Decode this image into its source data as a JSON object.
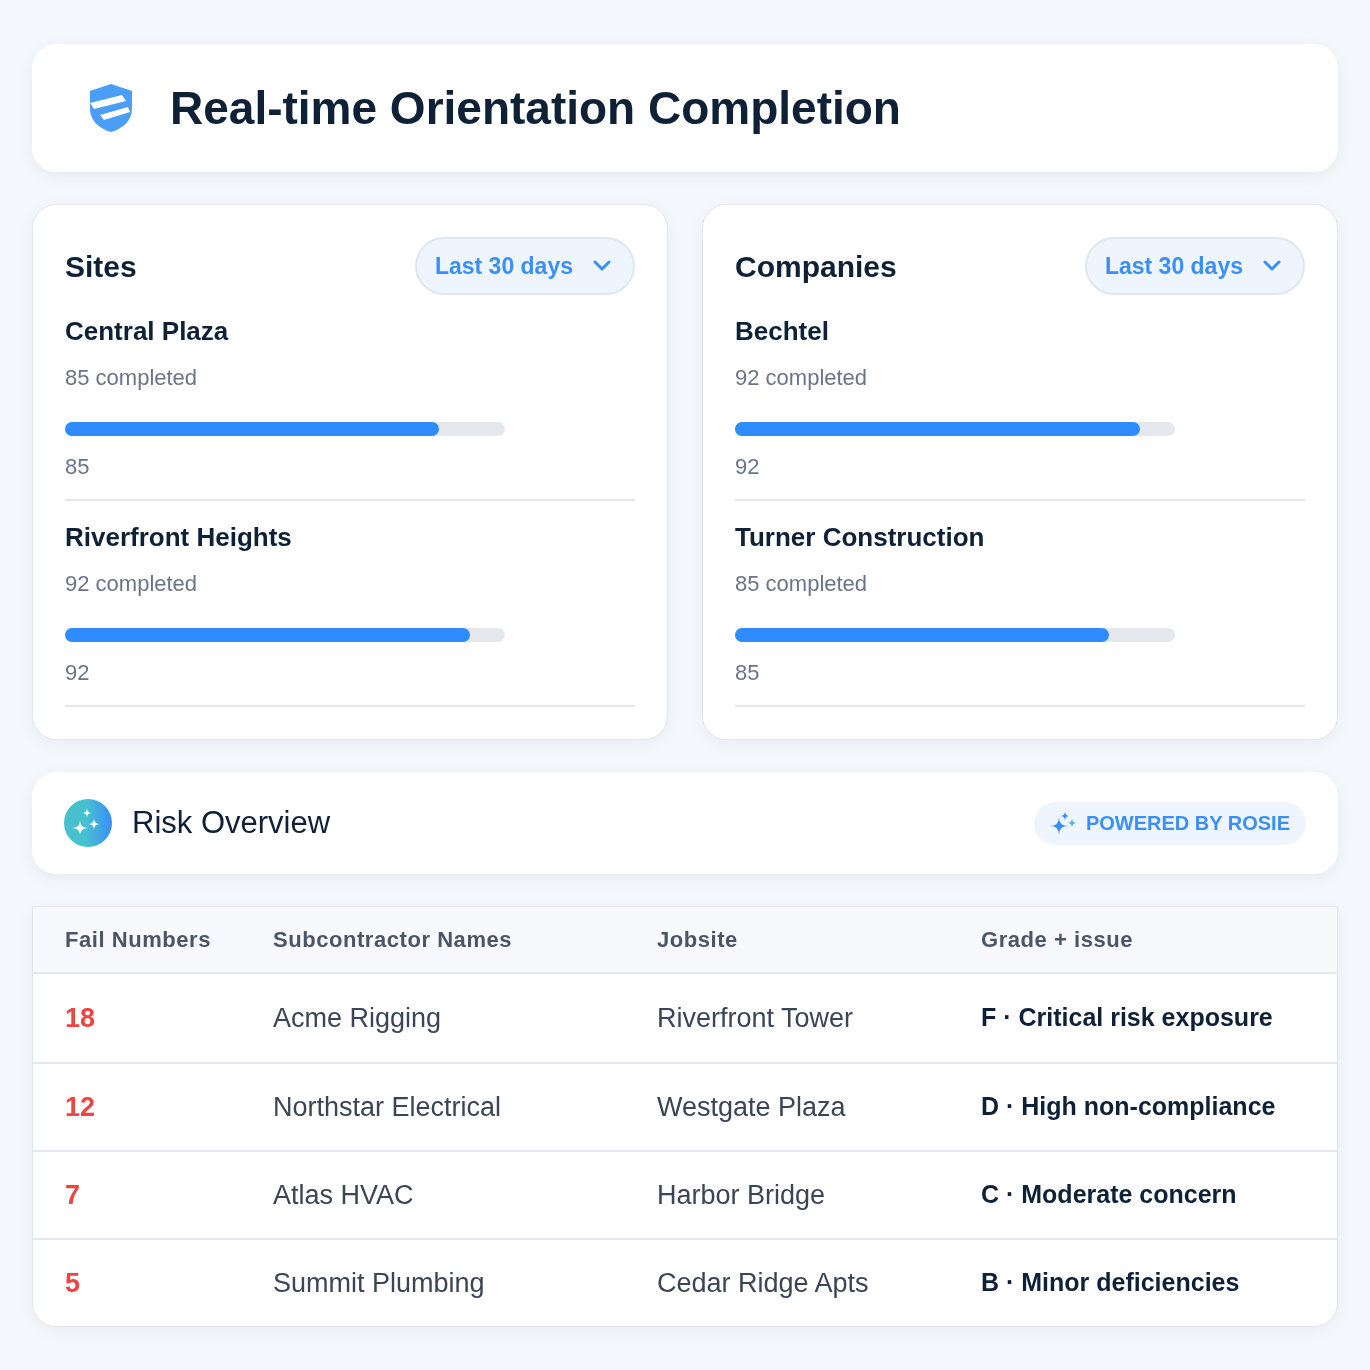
{
  "header": {
    "title": "Real-time Orientation Completion"
  },
  "panels": [
    {
      "title": "Sites",
      "filter": "Last 30 days",
      "items": [
        {
          "name": "Central Plaza",
          "completed": "85 completed",
          "level": 0.85,
          "value": "85"
        },
        {
          "name": "Riverfront Heights",
          "completed": "92 completed",
          "level": 0.92,
          "value": "92"
        }
      ]
    },
    {
      "title": "Companies",
      "filter": "Last 30 days",
      "items": [
        {
          "name": "Bechtel",
          "completed": "92 completed",
          "level": 0.92,
          "value": "92"
        },
        {
          "name": "Turner Construction",
          "completed": "85 completed",
          "level": 0.85,
          "value": "85"
        }
      ]
    }
  ],
  "risk_overview": {
    "title": "Risk Overview",
    "badge": "POWERED BY ROSIE"
  },
  "table": {
    "columns": [
      "Fail Numbers",
      "Subcontractor Names",
      "Jobsite",
      "Grade + issue"
    ],
    "rows": [
      {
        "fail_numbers": "18",
        "subcontractor": "Acme Rigging",
        "jobsite": "Riverfront Tower",
        "grade_issue": "F · Critical risk exposure"
      },
      {
        "fail_numbers": "12",
        "subcontractor": "Northstar Electrical",
        "jobsite": "Westgate Plaza",
        "grade_issue": "D · High non-compliance"
      },
      {
        "fail_numbers": "7",
        "subcontractor": "Atlas HVAC",
        "jobsite": "Harbor Bridge",
        "grade_issue": "C · Moderate concern"
      },
      {
        "fail_numbers": "5",
        "subcontractor": "Summit Plumbing",
        "jobsite": "Cedar Ridge Apts",
        "grade_issue": "B · Minor deficiencies"
      }
    ]
  }
}
